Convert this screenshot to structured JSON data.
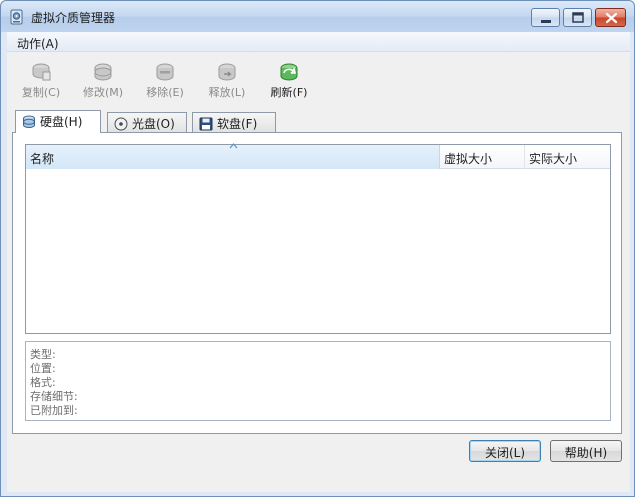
{
  "window": {
    "title": "虚拟介质管理器",
    "app_icon": "disk-manager-icon",
    "controls": [
      "minimize-icon",
      "maximize-icon",
      "close-icon"
    ]
  },
  "menu": {
    "items": [
      {
        "label": "动作(A)"
      }
    ]
  },
  "toolbar": {
    "buttons": [
      {
        "label": "复制(C)",
        "icon": "copy-disk-icon",
        "enabled": false
      },
      {
        "label": "修改(M)",
        "icon": "modify-disk-icon",
        "enabled": false
      },
      {
        "label": "移除(E)",
        "icon": "remove-disk-icon",
        "enabled": false
      },
      {
        "label": "释放(L)",
        "icon": "release-disk-icon",
        "enabled": false
      },
      {
        "label": "刷新(F)",
        "icon": "refresh-icon",
        "enabled": true
      }
    ]
  },
  "tabs": [
    {
      "label": "硬盘(H)",
      "icon": "hard-disk-icon",
      "active": true
    },
    {
      "label": "光盘(O)",
      "icon": "optical-disc-icon",
      "active": false
    },
    {
      "label": "软盘(F)",
      "icon": "floppy-disk-icon",
      "active": false
    }
  ],
  "list": {
    "columns": [
      "名称",
      "虚拟大小",
      "实际大小"
    ],
    "rows": []
  },
  "details": {
    "labels": [
      "类型:",
      "位置:",
      "格式:",
      "存储细节:",
      "已附加到:"
    ]
  },
  "buttons": {
    "close_label": "关闭(L)",
    "help_label": "帮助(H)"
  },
  "colors": {
    "title_gradient": "#c3d7f0",
    "close_button": "#c8452a",
    "refresh_green": "#3aa43a",
    "list_header_selected": "#d3e7f7"
  }
}
